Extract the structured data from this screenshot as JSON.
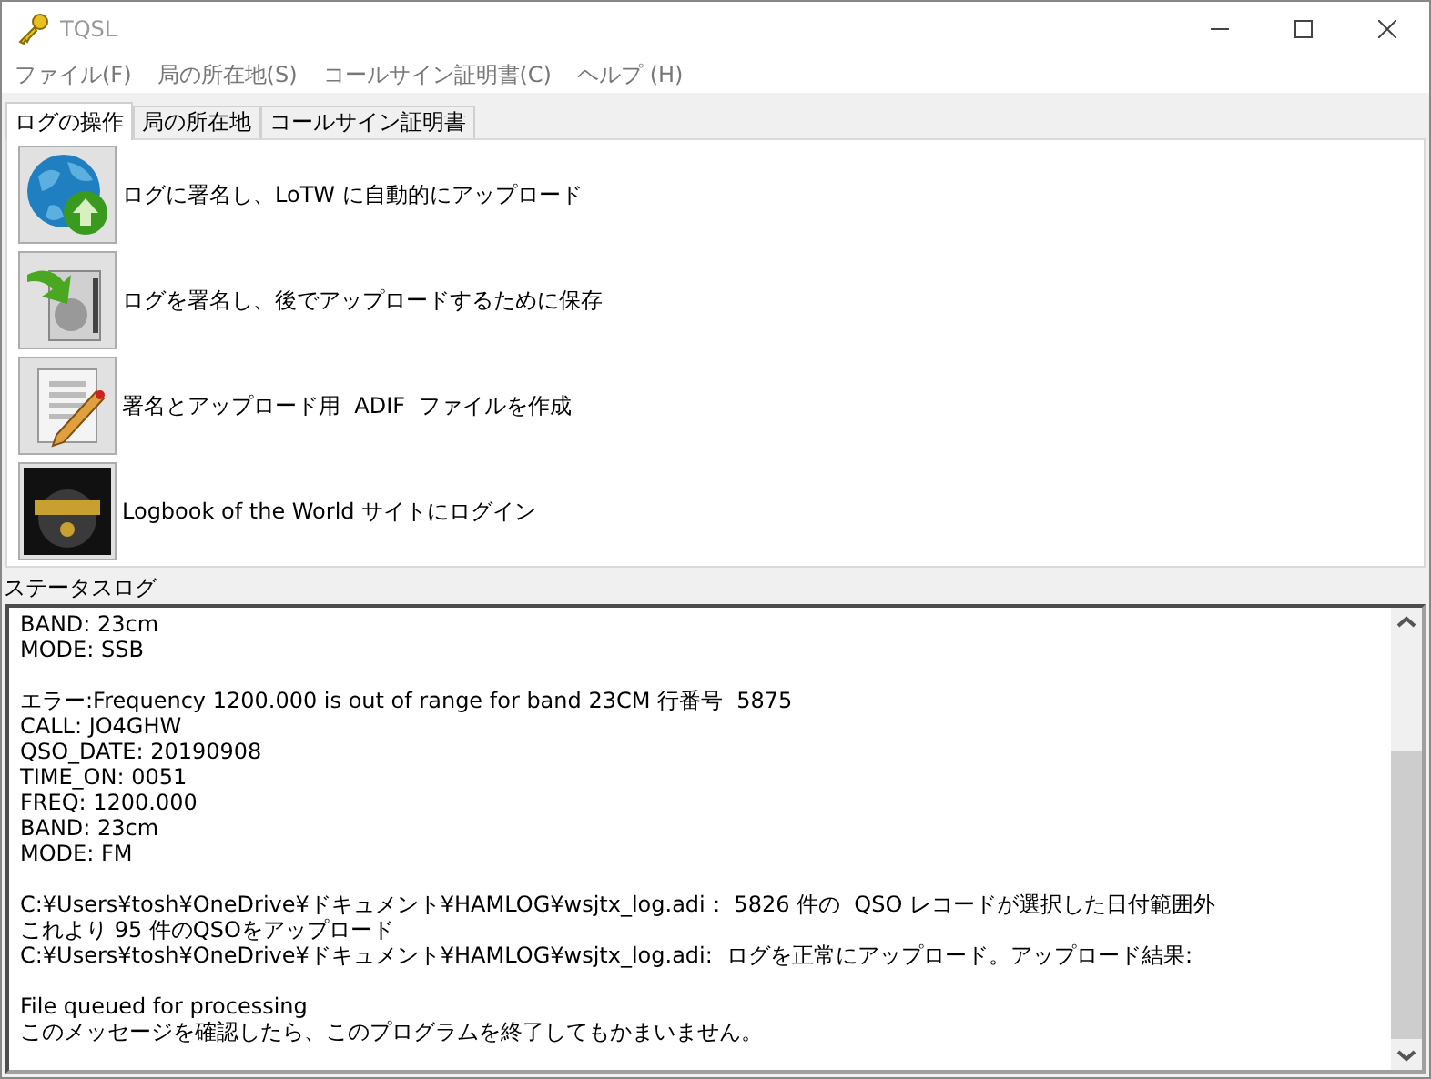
{
  "window": {
    "title": "TQSL",
    "active": false
  },
  "menu": [
    "ファイル(F)",
    "局の所在地(S)",
    "コールサイン証明書(C)",
    "ヘルプ (H)"
  ],
  "tabs": [
    {
      "label": "ログの操作",
      "selected": true
    },
    {
      "label": "局の所在地",
      "selected": false
    },
    {
      "label": "コールサイン証明書",
      "selected": false
    }
  ],
  "actions": [
    {
      "kind": "upload",
      "label": "ログに署名し、LoTW に自動的にアップロード"
    },
    {
      "kind": "save",
      "label": "ログを署名し、後でアップロードするために保存"
    },
    {
      "kind": "create",
      "label": "署名とアップロード用  ADIF  ファイルを作成"
    },
    {
      "kind": "login",
      "label": "Logbook of the World サイトにログイン"
    }
  ],
  "status_log": {
    "label": "ステータスログ",
    "paragraphs": [
      [
        "BAND: 23cm",
        "MODE: SSB"
      ],
      [
        "エラー:Frequency 1200.000 is out of range for band 23CM 行番号  5875",
        "CALL: JO4GHW",
        "QSO_DATE: 20190908",
        "TIME_ON: 0051",
        "FREQ: 1200.000",
        "BAND: 23cm",
        "MODE: FM"
      ],
      [
        "C:¥Users¥tosh¥OneDrive¥ドキュメント¥HAMLOG¥wsjtx_log.adi： 5826 件の  QSO レコードが選択した日付範囲外",
        "これより 95 件のQSOをアップロード",
        "C:¥Users¥tosh¥OneDrive¥ドキュメント¥HAMLOG¥wsjtx_log.adi:  ログを正常にアップロード。アップロード結果:"
      ],
      [
        "File queued for processing",
        "このメッセージを確認したら、このプログラムを終了してもかまいません。"
      ]
    ]
  }
}
